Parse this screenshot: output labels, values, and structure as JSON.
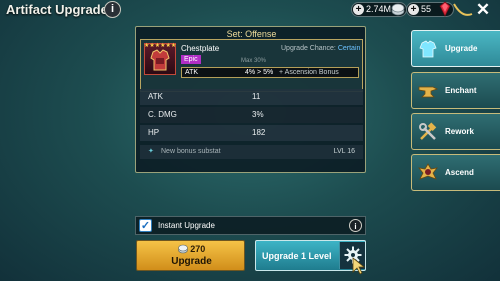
{
  "header": {
    "title": "Artifact Upgrade",
    "info_glyph": "i",
    "close_glyph": "✕",
    "resources": [
      {
        "name": "silver",
        "value": "2.74M",
        "icon": "silver-coin-icon"
      },
      {
        "name": "gems",
        "value": "55",
        "icon": "red-gem-icon"
      }
    ],
    "plus_glyph": "+"
  },
  "panel": {
    "set_title": "Set: Offense",
    "item": {
      "name": "Chestplate",
      "rarity": "Epic",
      "rarity_color": "#b12fc5",
      "stars": "★★★★★★",
      "upgrade_chance_label": "Upgrade Chance:",
      "upgrade_chance_value": "Certain",
      "max_label": "Max 30%",
      "main_stat": {
        "name": "ATK",
        "change": "4% > 5%",
        "bonus": "+ Ascension Bonus"
      }
    },
    "substats": [
      {
        "name": "ATK",
        "value": "11"
      },
      {
        "name": "C. DMG",
        "value": "3%"
      },
      {
        "name": "HP",
        "value": "182"
      }
    ],
    "bonus_row": {
      "star": "✦",
      "text": "New bonus substat",
      "level": "LVL 16"
    }
  },
  "tabs": [
    {
      "label": "Upgrade",
      "icon": "chestplate-icon",
      "active": true
    },
    {
      "label": "Enchant",
      "icon": "anvil-icon",
      "active": false
    },
    {
      "label": "Rework",
      "icon": "hammer-wrench-icon",
      "active": false
    },
    {
      "label": "Ascend",
      "icon": "ascend-crest-icon",
      "active": false
    }
  ],
  "bottom": {
    "instant_upgrade_label": "Instant Upgrade",
    "instant_upgrade_checked": true,
    "check_glyph": "✓",
    "info_glyph": "i",
    "upgrade_cost": "270",
    "upgrade_label": "Upgrade",
    "upgrade_level_label": "Upgrade 1 Level"
  },
  "colors": {
    "accent_cyan": "#3db4c6",
    "gold_button": "#f5c347",
    "chance_text": "#6cc1ff"
  }
}
